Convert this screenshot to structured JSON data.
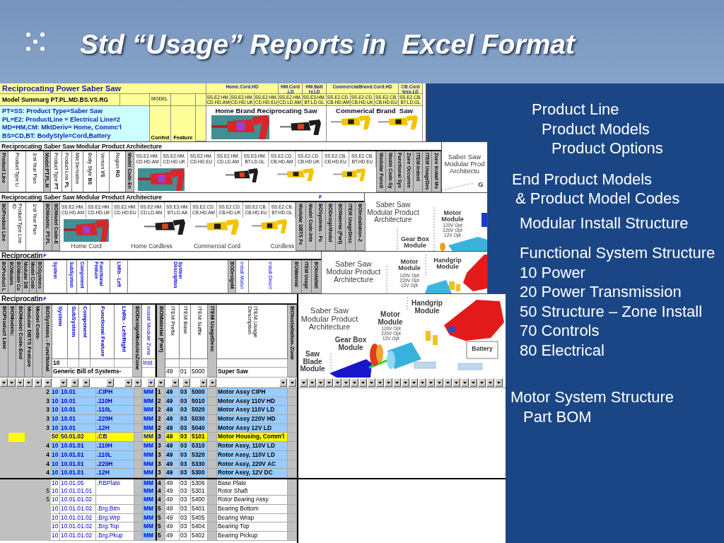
{
  "slide_title": "Std “Usage” Reports in  Excel Format",
  "summary_sheet": {
    "title": "Reciprocating Power Saber Saw",
    "model_summary": "Model Summarg PT.PL.MD.BS.VS.RG",
    "model_label": "MODEL",
    "model_groups": [
      {
        "label": "Home.Cord.HD",
        "codes": [
          "SS.E2.HM. CD.HD.AM",
          "SS.E2.HM. CD.HD.UK",
          "SS.E2.HM. CD.HD.EU"
        ]
      },
      {
        "label": "HM.Cord .LD",
        "codes": [
          "SS.E2.HM. CD.LD.AM"
        ]
      },
      {
        "label": "HM.Batt ry.LD",
        "codes": [
          "SS.E3.HM. BT.LD.GL"
        ]
      },
      {
        "label": "CommercialBrand.Cord.HD",
        "codes": [
          "SS.E2.CD. CB.HD.AM",
          "SS.E2.CD. CB.HD.UK",
          "SS.E2.CB. CB.HD.EU"
        ]
      },
      {
        "label": "CB.Cord less.LD",
        "codes": [
          "SS.E2.CB. BT.LD.GL"
        ]
      }
    ],
    "legend": [
      "PT=SS: Product Type=Saber Saw",
      "PL=E2: ProductLine = Electrical Line#2",
      "MD=HM,CM: MktDeriv= Home, Commc'l",
      "BS=CD,BT: BodyStyle=Cord,Battery"
    ],
    "side_headers": [
      "Confed",
      "Feature"
    ],
    "brands": [
      "Home Brand Reciprocating Saw",
      "Commerical Brand  Saw"
    ]
  },
  "architecture_sheet": {
    "title": "Reciprocating Saber Saw Modular Product Architecture",
    "attribute_columns": [
      {
        "label": "Product Line",
        "shaded": true
      },
      {
        "label": "Product Type Li",
        "shaded": false
      },
      {
        "label": "1rst Year Plan",
        "shaded": false
      },
      {
        "label": "Model:PT.PL.M",
        "shaded": true
      },
      {
        "label": "Product Type **PT**",
        "shaded": false
      },
      {
        "label": "Product Line **PL**",
        "shaded": false
      },
      {
        "label": "Mkt Derivative",
        "shaded": false
      },
      {
        "label": "Body Style **BS**",
        "shaded": false
      },
      {
        "label": "Version **VS**",
        "shaded": false
      },
      {
        "label": "Region **RG**",
        "shaded": false
      },
      {
        "label": "Model Code-En",
        "shaded": true
      }
    ],
    "model_codes": [
      "SS.E2.HM. CD.HD.AM",
      "SS.E2.HM. CD.HD.UK",
      "SS.E2.HM. CD.HD.EU",
      "SS.E2.HM. CD.LD.AM",
      "SS.E3.HM. BT.LD.GL",
      "SS.E2.CD. CB.HD.AM",
      "SS.E2.CD. CB.HD.UK",
      "SS.E2.CB. CB.HD.EU",
      "SS.E2.CB. BT.HD.EU"
    ],
    "structure_columns": [
      {
        "label": "Modular Functi",
        "shaded": true
      },
      {
        "label": "Model Code-Sy",
        "shaded": true
      },
      {
        "label": "Functional Sys",
        "shaded": true
      },
      {
        "label": "Zone Occurren",
        "shaded": true
      },
      {
        "label": "ITEM-Indent",
        "shaded": true
      },
      {
        "label": "ITEM UsageDes",
        "shaded": true
      },
      {
        "label": "Zone Install Mo",
        "shaded": true
      }
    ],
    "diagram_labels": [
      "Saber Saw Modular Prod Architectu",
      "G"
    ]
  },
  "architecture_sheet_2": {
    "title": "Reciprocating Saber Saw Modular Product Architecture",
    "flag": "F",
    "attribute_columns": [
      {
        "label": "BOProduct Line",
        "shaded": true
      },
      {
        "label": "Product Type Line ID",
        "shaded": false
      },
      {
        "label": "1rst Year Plan",
        "shaded": false
      },
      {
        "label": "BOModels: PT.PL",
        "shaded": true
      },
      {
        "label": "BOModel Code-E",
        "shaded": true
      }
    ],
    "model_codes": [
      "SS.E2.HM. CD.HD.AM",
      "SS.E2.HM. CD.HD.UK",
      "SS.E2.HM. CD.HD.EU",
      "SS.E2.HM. CD.LD.AM",
      "SS.E3.HM. BT.LD.AA",
      "SS.E2.CD. CB.HD.AM",
      "SS.E2.CD. CB.HD.UK",
      "SS.E2.CB. CB.HD.EU",
      "SS.E2.CB. BT.HD.GL"
    ],
    "captions": [
      "Home Cord",
      "Home Cordless",
      "Commercial Cord",
      "Cordless"
    ],
    "structure_columns": [
      {
        "label": "Modular DBTS Fe",
        "shaded": true
      },
      {
        "label": "Model Code-Inte",
        "shaded": true
      },
      {
        "label": "BOSystems - Fu",
        "shaded": true
      },
      {
        "label": "BODesignModul",
        "shaded": true
      },
      {
        "label": "BOMaterial (Part)",
        "shaded": true
      },
      {
        "label": "ITEM UsageDesc",
        "shaded": true
      },
      {
        "label": "BOInstallation-Z",
        "shaded": true
      }
    ],
    "diagram_labels": [
      "Saber Saw Modular Product Architecture",
      "Motor Module",
      "120V Opt 220V Opt 12V Opt",
      "Gear Box Module"
    ]
  },
  "bom_sheet": {
    "title": "Reciprocatin",
    "flag": "F",
    "columns": [
      {
        "label": "BOProduct L",
        "kind": "bo"
      },
      {
        "label": "BOModels",
        "kind": "bo"
      },
      {
        "label": "BOModel Co",
        "kind": "bo"
      },
      {
        "label": "Modular DB",
        "kind": "bo"
      },
      {
        "label": "Model Code",
        "kind": "bo"
      },
      {
        "label": "BOSystems",
        "kind": "bo"
      },
      {
        "label": "System",
        "kind": "system"
      },
      {
        "label": "SubSystem",
        "kind": "system"
      },
      {
        "label": "Component",
        "kind": "system"
      },
      {
        "label": "Functional Feature",
        "kind": "system"
      },
      {
        "label": "LhRh - Left",
        "kind": "system"
      },
      {
        "label": "System Description",
        "kind": "system"
      },
      {
        "label": "BODesignM",
        "kind": "bo"
      },
      {
        "label": "Install Modul",
        "kind": "install"
      },
      {
        "label": "Install Descri",
        "kind": "install"
      },
      {
        "label": "BOMaterial",
        "kind": "bo"
      },
      {
        "label": "ITEM Usage",
        "kind": "bo"
      },
      {
        "label": "BOInstallati",
        "kind": "bo"
      }
    ],
    "diagram_labels": [
      "Saber Saw Modular Product Architecture",
      "Motor Module",
      "120V Opt 220V Opt 12V Opt",
      "Handgrip Module"
    ]
  },
  "usage_report": {
    "title": "Reciprocatin",
    "flag": "F",
    "columns": [
      {
        "label": "BOProduct Line",
        "kind": "bo",
        "filtered": false
      },
      {
        "label": "BOModels:",
        "kind": "bo",
        "filtered": false
      },
      {
        "label": "BOModel Code-End",
        "kind": "bo",
        "filtered": false
      },
      {
        "label": "Modular DBTS Feature",
        "kind": "bo",
        "filtered": false
      },
      {
        "label": "Model Code-",
        "kind": "bo",
        "filtered": false
      },
      {
        "label": "BOSystems - Functional",
        "kind": "bo",
        "filtered": false
      },
      {
        "label": "System",
        "kind": "system",
        "filtered": false
      },
      {
        "label": "SubSystem",
        "kind": "system",
        "filtered": false
      },
      {
        "label": "Component",
        "kind": "system",
        "filtered": false
      },
      {
        "label": "Functional Feature",
        "kind": "system",
        "filtered": false
      },
      {
        "label": "LhRh - Left/Right",
        "kind": "system",
        "filtered": false
      },
      {
        "label": "BODesignModulesZone",
        "kind": "bo",
        "filtered": false
      },
      {
        "label": "Install Module Zone",
        "kind": "install",
        "filtered": true
      },
      {
        "label": "BOMaterial (Part)",
        "kind": "bo",
        "filtered": false
      },
      {
        "label": "ITEM Prefix",
        "kind": "item",
        "filtered": false
      },
      {
        "label": "ITEM Base",
        "kind": "item",
        "filtered": false
      },
      {
        "label": "ITEM Suffix",
        "kind": "item",
        "filtered": false
      },
      {
        "label": "ITEM UsageDesc",
        "kind": "bo",
        "filtered": false
      },
      {
        "label": "ITEM Usage Description",
        "kind": "item",
        "filtered": false
      },
      {
        "label": "BOInstallation-Zone",
        "kind": "bo",
        "filtered": false
      }
    ],
    "header_values": {
      "system": "10",
      "install_zone": "Inst",
      "description": "Generic Bill of Systems-",
      "prefix": "49",
      "base": "01",
      "suffix": "5000",
      "usage": "Super Saw"
    },
    "rows": [
      {
        "level": "2",
        "system": "10",
        "subsystem": "10.01",
        "feature": ".CIPH",
        "zone": "MM",
        "bom_level": "1",
        "prefix": "49",
        "base": "03",
        "suffix": "5000",
        "description": "Motor Assy CIPH",
        "kind": "assembly",
        "color": "#99ccff"
      },
      {
        "level": "3",
        "system": "10",
        "subsystem": "10.01",
        "feature": ".110H",
        "zone": "MM",
        "bom_level": "2",
        "prefix": "49",
        "base": "03",
        "suffix": "5010",
        "description": "Motor Assy 110V HD",
        "kind": "assembly",
        "color": "#99ccff"
      },
      {
        "level": "3",
        "system": "10",
        "subsystem": "10.01",
        "feature": ".110L",
        "zone": "MM",
        "bom_level": "2",
        "prefix": "49",
        "base": "03",
        "suffix": "5020",
        "description": "Motor Assy 110V LD",
        "kind": "assembly",
        "color": "#99ccff"
      },
      {
        "level": "3",
        "system": "10",
        "subsystem": "10.01",
        "feature": ".220H",
        "zone": "MM",
        "bom_level": "2",
        "prefix": "49",
        "base": "03",
        "suffix": "5030",
        "description": "Motor Assy 220V HD",
        "kind": "assembly",
        "color": "#99ccff"
      },
      {
        "level": "3",
        "system": "10",
        "subsystem": "10.01",
        "feature": ".12H",
        "zone": "MM",
        "bom_level": "2",
        "prefix": "49",
        "base": "03",
        "suffix": "5040",
        "description": "Motor Assy 12V LD",
        "kind": "assembly",
        "color": "#99ccff"
      },
      {
        "system": "50",
        "subsystem": "50.01.02",
        "feature": ".CB",
        "zone": "MM",
        "bom_level": "3",
        "prefix": "49",
        "base": "03",
        "suffix": "5101",
        "description": "Motor Housing, Comm'l",
        "kind": "flagged",
        "color": "#ffff00"
      },
      {
        "level": "4",
        "system": "10",
        "subsystem": "10.01.01",
        "feature": ".110H",
        "zone": "MM",
        "bom_level": "3",
        "prefix": "49",
        "base": "03",
        "suffix": "5310",
        "description": "Rotor Assy, 110V LD",
        "kind": "assembly",
        "color": "#99ccff"
      },
      {
        "level": "4",
        "system": "10",
        "subsystem": "10.01.01",
        "feature": ".110L",
        "zone": "MM",
        "bom_level": "3",
        "prefix": "49",
        "base": "03",
        "suffix": "5320",
        "description": "Rotor Assy, 110V LD",
        "kind": "assembly",
        "color": "#99ccff"
      },
      {
        "level": "4",
        "system": "10",
        "subsystem": "10.01.01",
        "feature": ".220H",
        "zone": "MM",
        "bom_level": "3",
        "prefix": "49",
        "base": "03",
        "suffix": "5330",
        "description": "Rotor Assy, 220V AC",
        "kind": "assembly",
        "color": "#99ccff"
      },
      {
        "level": "4",
        "system": "10",
        "subsystem": "10.01.01",
        "feature": ".12H",
        "zone": "MM",
        "bom_level": "3",
        "prefix": "49",
        "base": "03",
        "suffix": "5300",
        "description": "Rotor Assy, 12V DC",
        "kind": "assembly",
        "color": "#99ccff"
      },
      {
        "system": "10",
        "subsystem": "10.01.05",
        "feature": ".RBPlate",
        "zone": "MM",
        "bom_level": "4",
        "prefix": "49",
        "base": "03",
        "suffix": "5306",
        "description": "Base Plate",
        "kind": "part",
        "color": "#ffffff"
      },
      {
        "level": "5",
        "system": "10",
        "subsystem": "10.01.01.01",
        "zone": "MM",
        "bom_level": "4",
        "prefix": "49",
        "base": "03",
        "suffix": "5301",
        "description": "Rotor Shaft",
        "kind": "part",
        "color": "#ffffff"
      },
      {
        "level": "5",
        "system": "10",
        "subsystem": "10.01.01.02",
        "zone": "MM",
        "bom_level": "4",
        "prefix": "49",
        "base": "03",
        "suffix": "5400",
        "description": "Rotor Bearing Assy",
        "kind": "part",
        "color": "#ffffff"
      },
      {
        "system": "10",
        "subsystem": "10.01.01.02",
        "feature": ".Brg.Btm",
        "zone": "MM",
        "bom_level": "5",
        "prefix": "49",
        "base": "03",
        "suffix": "5401",
        "description": "Bearing Bottom",
        "kind": "part",
        "color": "#ffffff"
      },
      {
        "system": "10",
        "subsystem": "10.01.01.02",
        "feature": ".Brg.Wrp",
        "zone": "MM",
        "bom_level": "5",
        "prefix": "49",
        "base": "03",
        "suffix": "5405",
        "description": "Bearing Wrap",
        "kind": "part",
        "color": "#ffffff"
      },
      {
        "system": "10",
        "subsystem": "10.01.01.02",
        "feature": ".Brg.Top",
        "zone": "MM",
        "bom_level": "5",
        "prefix": "49",
        "base": "03",
        "suffix": "5404",
        "description": "Bearing Top",
        "kind": "part",
        "color": "#ffffff"
      },
      {
        "system": "10",
        "subsystem": "10.01.01.02",
        "feature": ".Brg.Pkup",
        "zone": "MM",
        "bom_level": "5",
        "prefix": "49",
        "base": "03",
        "suffix": "5402",
        "description": "Bearing Pickup",
        "kind": "part",
        "color": "#ffffff"
      }
    ],
    "diagram_labels": [
      "Saber Saw Modular Product Architecture",
      "Gear Box Module",
      "Motor Module",
      "120V Opt 220V Opt 12V Opt",
      "Handgrip Module",
      "Saw Blade Module",
      "Battery"
    ]
  },
  "notes": [
    {
      "text": "Product Line",
      "children": [
        {
          "text": "Product Models",
          "children": [
            {
              "text": "Product Options"
            }
          ]
        }
      ]
    },
    {
      "text": "End Product Models",
      "children": [
        {
          "text": "& Product Model Codes"
        }
      ]
    },
    {
      "text": "Modular Install Structure"
    },
    {
      "text": "Functional System Structure",
      "items": [
        "10 Power",
        "20 Power Transmission",
        "50 Structure – Zone Install",
        "70 Controls",
        "80 Electrical"
      ]
    },
    {
      "text": "Motor System Structure",
      "children": [
        {
          "text": "Part BOM"
        }
      ]
    }
  ]
}
